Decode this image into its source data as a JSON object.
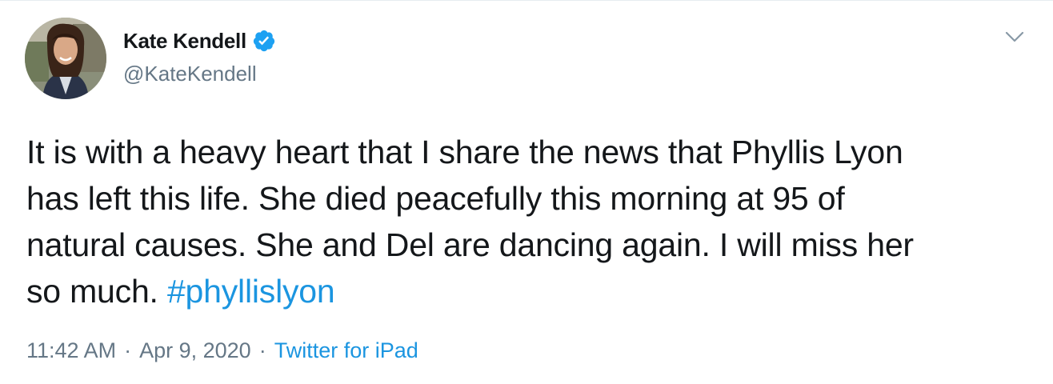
{
  "author": {
    "display_name": "Kate Kendell",
    "handle": "@KateKendell",
    "verified": true
  },
  "tweet": {
    "lines": [
      "It is with a heavy heart that I share the news that Phyllis Lyon",
      "has left this life. She died peacefully this morning at 95 of",
      "natural causes. She and Del are dancing again. I will miss her"
    ],
    "last_line_text": "so much. ",
    "hashtag": "#phyllislyon"
  },
  "meta": {
    "time": "11:42 AM",
    "separator": "·",
    "date": "Apr 9, 2020",
    "source": "Twitter for iPad"
  },
  "colors": {
    "link": "#1b95e0",
    "text": "#14171a",
    "secondary": "#657786",
    "verified": "#1da1f2"
  },
  "icons": {
    "verified": "verified-badge-icon",
    "menu": "chevron-down-icon"
  }
}
